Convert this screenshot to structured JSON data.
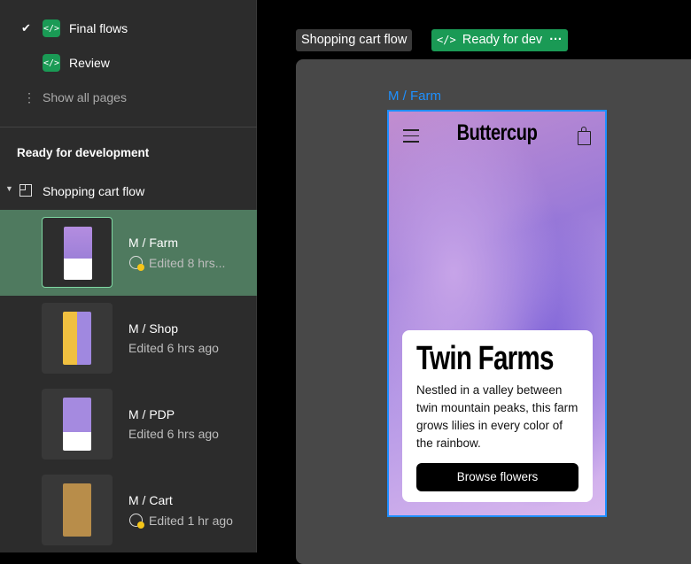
{
  "sidebar": {
    "pages": [
      {
        "label": "Final flows",
        "selected": true
      },
      {
        "label": "Review",
        "selected": false
      }
    ],
    "show_all": "Show all pages",
    "section_title": "Ready for development",
    "flow_name": "Shopping cart flow",
    "frames": [
      {
        "name": "M / Farm",
        "edited": "Edited 8 hrs...",
        "has_changes": true,
        "selected": true
      },
      {
        "name": "M / Shop",
        "edited": "Edited 6 hrs ago",
        "has_changes": false
      },
      {
        "name": "M / PDP",
        "edited": "Edited 6 hrs ago",
        "has_changes": false
      },
      {
        "name": "M / Cart",
        "edited": "Edited 1 hr ago",
        "has_changes": true
      }
    ]
  },
  "canvas": {
    "flow_tag": "Shopping cart flow",
    "status_tag": "Ready for dev",
    "frame_label": "M / Farm",
    "phone": {
      "brand": "Buttercup",
      "title": "Twin Farms",
      "body": "Nestled in a valley between twin mountain peaks, this farm grows lilies in every color of the rainbow.",
      "button": "Browse flowers"
    }
  },
  "colors": {
    "accent": "#1e8fff",
    "dev_green": "#1a9a55",
    "selected_row": "#4f7a5f",
    "badge_dot": "#f5c518"
  }
}
